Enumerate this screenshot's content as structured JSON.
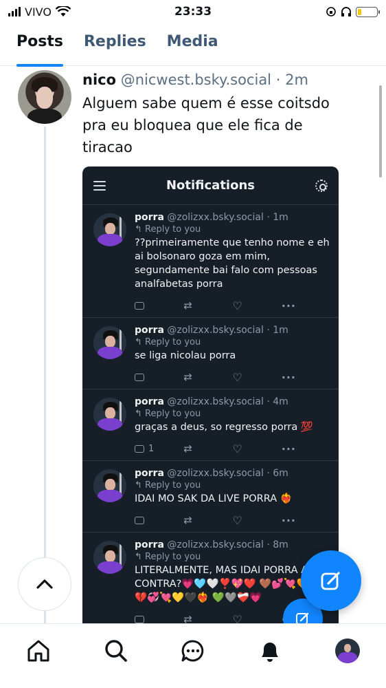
{
  "status_bar": {
    "carrier": "VIVO",
    "time": "23:33",
    "battery_level": 0.2,
    "battery_color": "#f6c700"
  },
  "tabs": [
    {
      "label": "Posts",
      "active": true
    },
    {
      "label": "Replies",
      "active": false
    },
    {
      "label": "Media",
      "active": false
    }
  ],
  "post": {
    "author_name": "nico",
    "author_handle": "@nicwest.bsky.social",
    "separator": "·",
    "time": "2m",
    "text": "Alguem sabe quem é esse coitsdo pra eu bloquea que ele fica de tiracao"
  },
  "embed": {
    "title": "Notifications",
    "notifications": [
      {
        "name": "porra",
        "handle": "@zolizxx.bsky.social",
        "time": "· 1m",
        "reply_label": "↰ Reply to you",
        "text": "??primeiramente que tenho nome e eh ai bolsonaro goza em mim, segundamente bai falo com pessoas analfabetas porra",
        "reply_count": ""
      },
      {
        "name": "porra",
        "handle": "@zolizxx.bsky.social",
        "time": "· 1m",
        "reply_label": "↰ Reply to you",
        "text": "se liga nicolau porra",
        "reply_count": ""
      },
      {
        "name": "porra",
        "handle": "@zolizxx.bsky.social",
        "time": "· 4m",
        "reply_label": "↰ Reply to you",
        "text": "graças a deus, so regresso porra 💯",
        "reply_count": "1"
      },
      {
        "name": "porra",
        "handle": "@zolizxx.bsky.social",
        "time": "· 6m",
        "reply_label": "↰ Reply to you",
        "text": "IDAI MO SAK DA LIVE PORRA ❤️‍🔥",
        "reply_count": ""
      },
      {
        "name": "porra",
        "handle": "@zolizxx.bsky.social",
        "time": "· 8m",
        "reply_label": "↰ Reply to you",
        "text": "LITERALMENTE, MAS IDAI PORRA ALGO CONTRA?💗🩵🤍❣️💖❤️ 🤎💕💘🧡💜💔💞💘💛🖤❤️‍🔥 💚🩶❤️‍🩹💗",
        "reply_count": ""
      }
    ]
  },
  "icons": {
    "scroll_top": "chevron-up-icon",
    "compose": "compose-icon",
    "nav": [
      "home-icon",
      "search-icon",
      "chat-icon",
      "bell-icon",
      "profile-avatar"
    ]
  },
  "colors": {
    "accent": "#1185fe",
    "embed_bg": "#161e27",
    "muted": "#5b6f83"
  }
}
